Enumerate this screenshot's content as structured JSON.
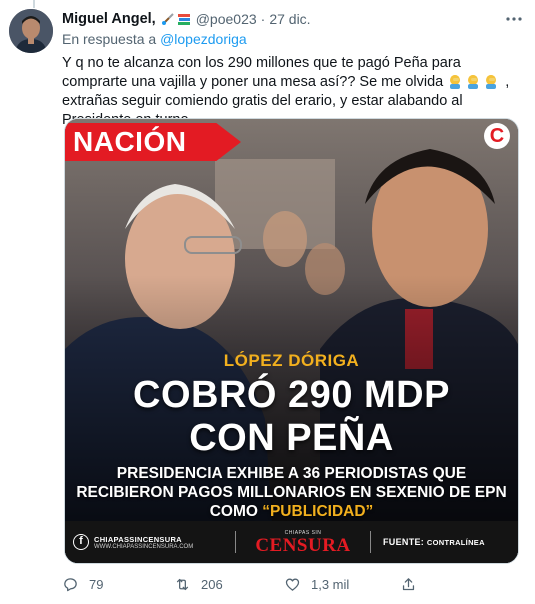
{
  "tweet": {
    "display_name": "Miguel Angel,",
    "handle": "@poe023",
    "date": "27 dic.",
    "reply_prefix": "En respuesta a",
    "reply_to": "@lopezdoriga",
    "text_part1": "Y q no te alcanza con los 290 millones que te pagó Peña para comprarte una vajilla y poner una mesa así?? Se me olvida",
    "text_part2": ", extrañas seguir comiendo gratis del erario, y estar alabando al Presidente en turno…"
  },
  "media": {
    "section_tag": "NACIÓN",
    "brand_letter": "C",
    "kicker": "LÓPEZ DÓRIGA",
    "headline_line1": "COBRÓ 290 MDP",
    "headline_line2": "CON PEÑA",
    "subhead_line1": "PRESIDENCIA EXHIBE A 36 PERIODISTAS QUE",
    "subhead_line2": "RECIBIERON PAGOS MILLONARIOS EN SEXENIO DE EPN",
    "subhead_line3_plain": "COMO ",
    "subhead_line3_quoted": "“PUBLICIDAD”",
    "footer_name": "CHIAPASSINCENSURA",
    "footer_url": "WWW.CHIAPASSINCENSURA.COM",
    "censura_top": "CHIAPAS SIN",
    "censura_main": "CENSURA",
    "source_label": "FUENTE:",
    "source_value": "CONTRALÍNEA"
  },
  "actions": {
    "replies": "79",
    "retweets": "206",
    "likes": "1,3 mil"
  },
  "icons": {
    "more": "more-icon",
    "reply": "reply-icon",
    "retweet": "retweet-icon",
    "like": "heart-icon",
    "share": "share-icon"
  },
  "colors": {
    "link": "#1d9bf0",
    "secondary_text": "#536471",
    "brand_red": "#e31b23",
    "headline_yellow": "#f2b01e"
  }
}
